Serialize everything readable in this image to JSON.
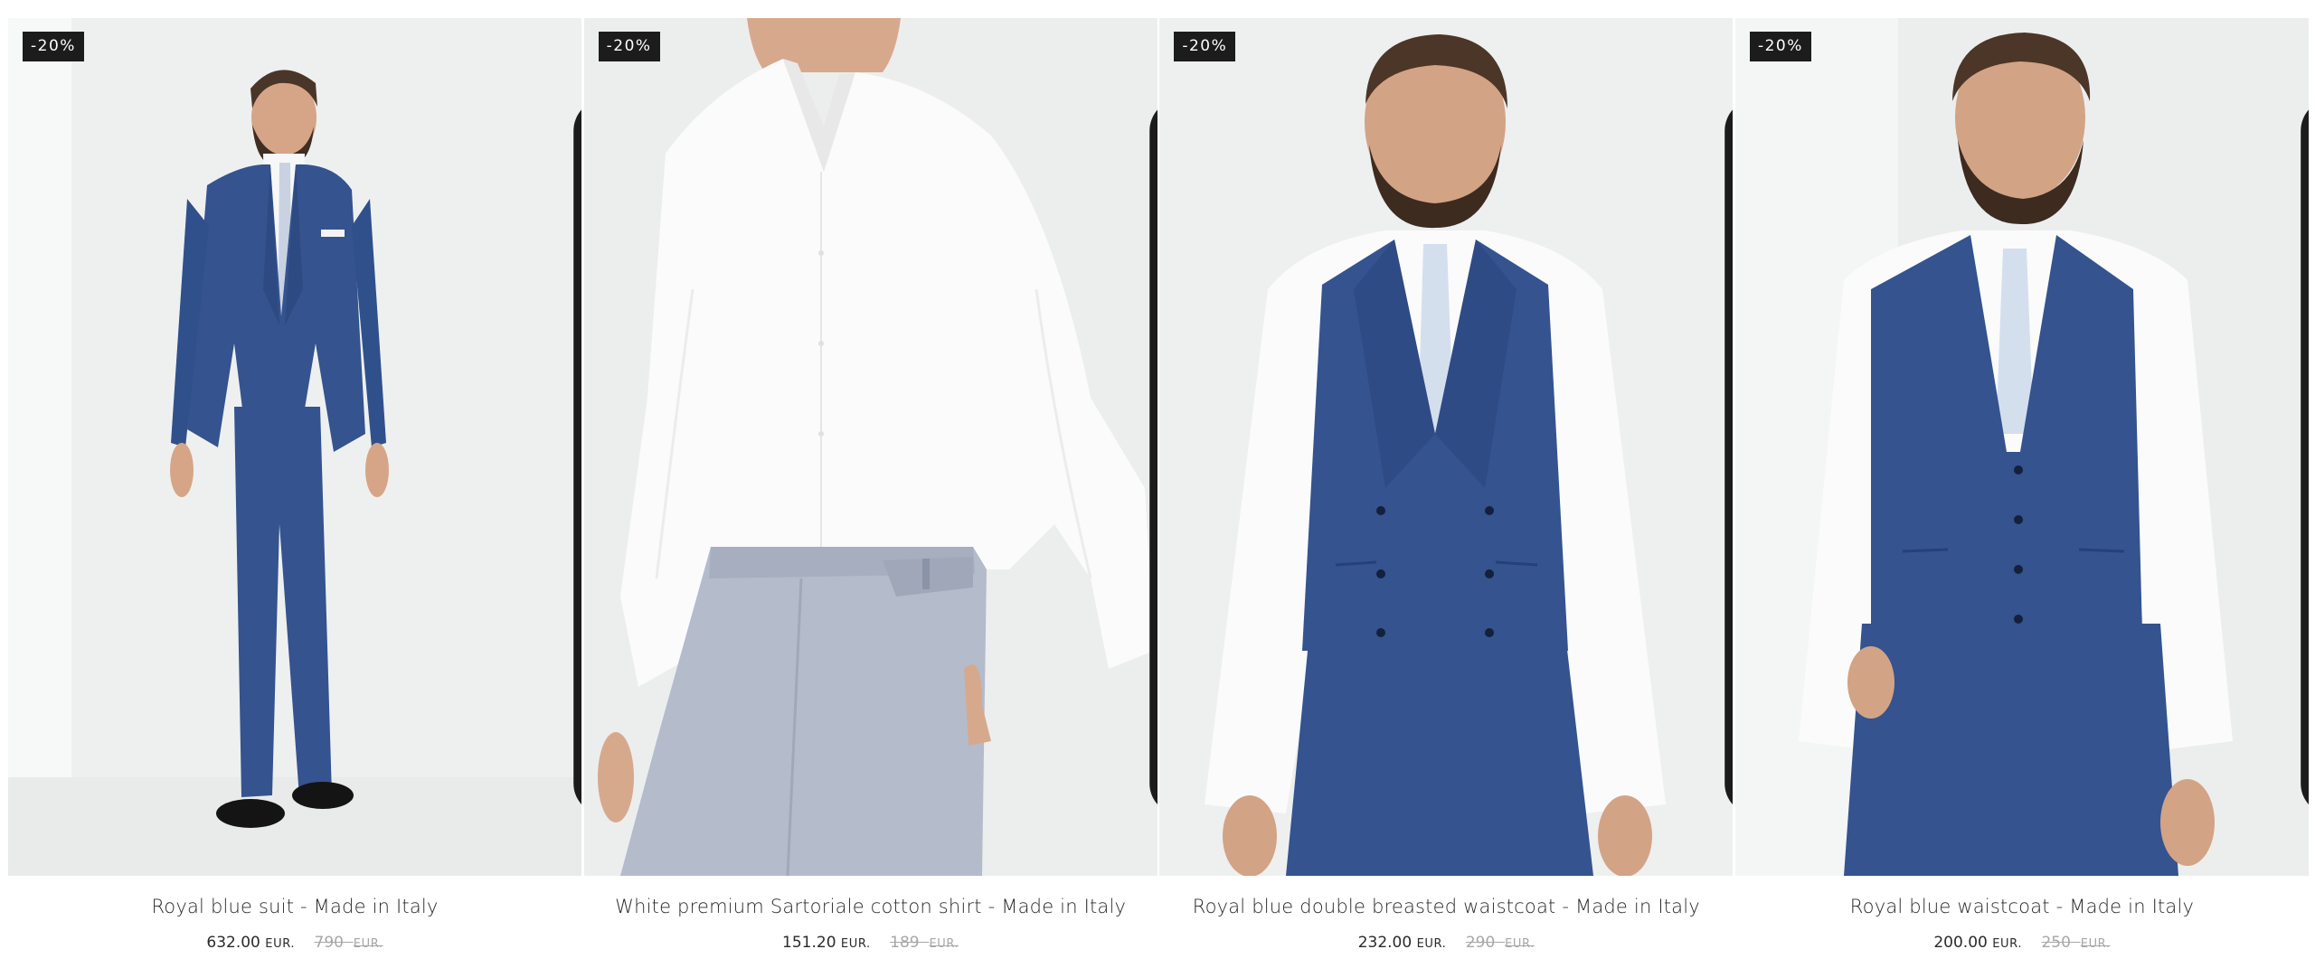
{
  "products": [
    {
      "discount_badge": "-20%",
      "name": "Royal blue suit - Made in Italy",
      "price": "632.00",
      "currency": "EUR.",
      "old_price": "790",
      "old_currency": "EUR.",
      "image_subject": "model-in-royal-blue-suit",
      "bookmark_icon": "bookmark-icon"
    },
    {
      "discount_badge": "-20%",
      "name": "White premium Sartoriale cotton shirt - Made in Italy",
      "price": "151.20",
      "currency": "EUR.",
      "old_price": "189",
      "old_currency": "EUR.",
      "image_subject": "model-in-white-shirt",
      "bookmark_icon": "bookmark-icon"
    },
    {
      "discount_badge": "-20%",
      "name": "Royal blue double breasted waistcoat - Made in Italy",
      "price": "232.00",
      "currency": "EUR.",
      "old_price": "290",
      "old_currency": "EUR.",
      "image_subject": "model-in-double-breasted-waistcoat",
      "bookmark_icon": "bookmark-icon"
    },
    {
      "discount_badge": "-20%",
      "name": "Royal blue waistcoat - Made in Italy",
      "price": "200.00",
      "currency": "EUR.",
      "old_price": "250",
      "old_currency": "EUR.",
      "image_subject": "model-in-royal-blue-waistcoat",
      "bookmark_icon": "bookmark-icon"
    }
  ],
  "colors": {
    "badge_bg": "#1c1c1c",
    "suit_blue": "#34538f",
    "shirt_white": "#fbfbfb",
    "trouser_grey": "#b4bbcb",
    "old_price": "#a7a7a7"
  }
}
